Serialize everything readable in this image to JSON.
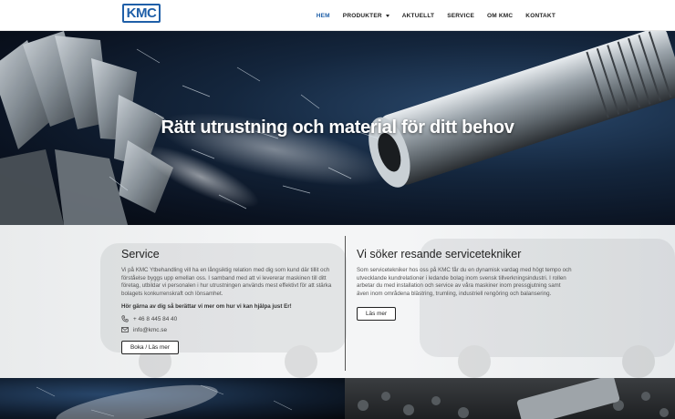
{
  "logo": {
    "text": "KMC"
  },
  "nav": {
    "items": [
      {
        "label": "HEM",
        "active": true
      },
      {
        "label": "PRODUKTER",
        "dropdown": true
      },
      {
        "label": "AKTUELLT"
      },
      {
        "label": "SERVICE"
      },
      {
        "label": "OM KMC"
      },
      {
        "label": "KONTAKT"
      }
    ]
  },
  "hero": {
    "title": "Rätt utrustning och material för ditt behov"
  },
  "service": {
    "title": "Service",
    "body": "Vi på KMC Ytbehandling vill ha en långsiktig relation med dig som kund där tillit och förståelse byggs upp emellan oss. I samband med att vi levererar maskinen till ditt företag, utbildar vi personalen i hur utrustningen används mest effektivt för att stärka bolagets konkurrenskraft och lönsamhet.",
    "cta_text": "Hör gärna av dig så berättar vi mer om hur vi kan hjälpa just Er!",
    "phone": "+ 46 8 445 84 40",
    "email": "info@kmc.se",
    "button_label": "Boka / Läs mer"
  },
  "jobs": {
    "title": "Vi söker resande servicetekniker",
    "body": "Som servicetekniker hos oss på KMC får du en dynamisk vardag med högt tempo och utvecklande kundrelationer i ledande bolag inom svensk tillverkningsindustri. I rollen arbetar du med installation och service av våra maskiner inom pressgjutning samt även inom områdena blästring, trumling, industriell rengöring och balansering.",
    "button_label": "Läs mer"
  },
  "colors": {
    "brand": "#1f5fa8",
    "hero_bg": "#14263d",
    "band_bg": "#eef0f1"
  },
  "icons": {
    "phone": "phone-icon",
    "email": "envelope-icon"
  }
}
